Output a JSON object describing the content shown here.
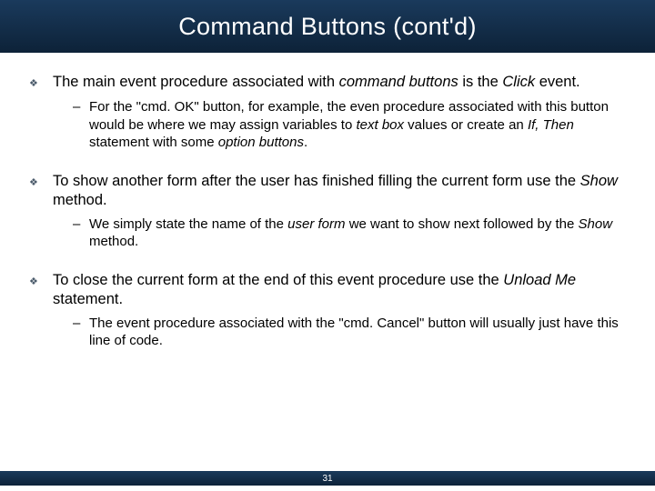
{
  "slide": {
    "title": "Command Buttons (cont'd)",
    "page_number": "31"
  },
  "bullets": [
    {
      "text_html": "The main event procedure associated with <i>command buttons</i> is the <i>Click</i> event.",
      "sub_html": "For the \"cmd. OK\" button, for example, the even procedure associated with this button would be where we may assign variables to <i>text box</i> values or create an <i>If, Then</i> statement with some <i>option buttons</i>."
    },
    {
      "text_html": "To show another form after the user has finished filling the current form use the <i>Show</i> method.",
      "sub_html": "We simply state the name of the <i>user form</i> we want to show next followed by the <i>Show</i> method."
    },
    {
      "text_html": "To close the current form at the end of this event procedure  use the <i>Unload Me</i> statement.",
      "sub_html": "The event procedure associated with the \"cmd. Cancel\" button will usually just have this line of code."
    }
  ]
}
